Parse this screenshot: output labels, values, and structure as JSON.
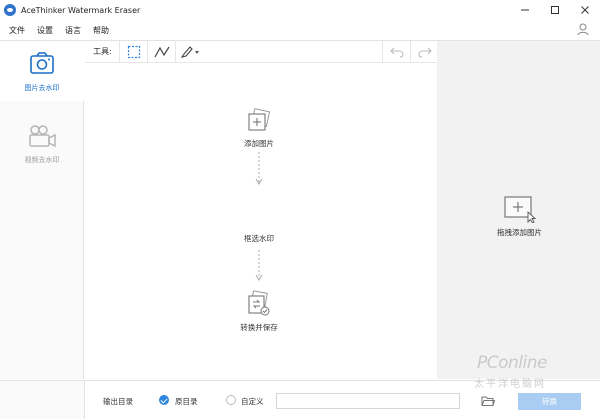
{
  "window": {
    "title": "AceThinker Watermark Eraser",
    "controls": [
      "minimize",
      "maximize",
      "close"
    ]
  },
  "menu": {
    "items": [
      "文件",
      "设置",
      "语言",
      "帮助"
    ]
  },
  "sidebar": {
    "items": [
      {
        "label": "图片去水印",
        "icon": "image-icon",
        "active": true
      },
      {
        "label": "视频去水印",
        "icon": "video-camera-icon",
        "active": false
      }
    ]
  },
  "toolbar": {
    "label": "工具:",
    "tools": [
      "rect-select-icon",
      "polyline-icon",
      "brush-icon"
    ],
    "undo_icon": "undo-icon",
    "redo_icon": "redo-icon"
  },
  "workflow": {
    "steps": [
      {
        "label": "添加图片",
        "icon": "add-image-icon"
      },
      {
        "label": "框选水印",
        "icon": "select-watermark-icon"
      },
      {
        "label": "转换并保存",
        "icon": "convert-save-icon"
      }
    ]
  },
  "drop_panel": {
    "label": "拖拽添加图片",
    "icon": "drop-add-icon"
  },
  "footer": {
    "output_label": "输出目录",
    "option_original": "原目录",
    "option_custom": "自定义",
    "selected": "原目录",
    "path_value": "",
    "convert_label": "转换"
  },
  "watermark_overlay": {
    "text": "PConline",
    "sub": "太平洋电脑网"
  },
  "colors": {
    "accent": "#1b6fc7",
    "convert_button": "#a9cdf2",
    "right_panel": "#f2f2f2"
  }
}
